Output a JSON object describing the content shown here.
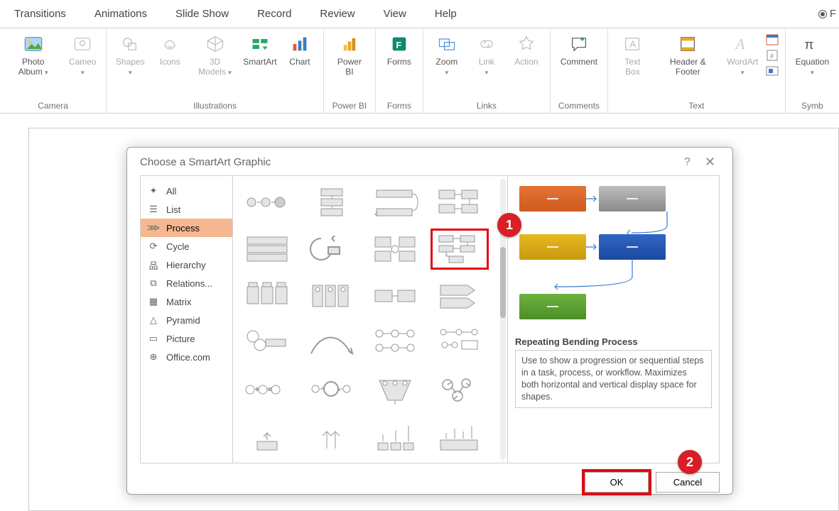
{
  "menu": [
    "Transitions",
    "Animations",
    "Slide Show",
    "Record",
    "Review",
    "View",
    "Help"
  ],
  "ribbon": {
    "camera": {
      "label": "Camera",
      "items": [
        {
          "label": "Photo Album",
          "chev": true,
          "d": false
        },
        {
          "label": "Cameo",
          "chev": true,
          "d": true
        }
      ]
    },
    "illustrations": {
      "label": "Illustrations",
      "items": [
        {
          "label": "Shapes",
          "chev": true,
          "d": true
        },
        {
          "label": "Icons",
          "d": true
        },
        {
          "label": "3D Models",
          "chev": true,
          "d": true
        },
        {
          "label": "SmartArt",
          "d": false
        },
        {
          "label": "Chart",
          "d": false
        }
      ]
    },
    "powerbi": {
      "label": "Power BI",
      "items": [
        {
          "label": "Power BI",
          "d": false
        }
      ]
    },
    "forms": {
      "label": "Forms",
      "items": [
        {
          "label": "Forms",
          "d": false
        }
      ]
    },
    "links": {
      "label": "Links",
      "items": [
        {
          "label": "Zoom",
          "chev": true,
          "d": false
        },
        {
          "label": "Link",
          "chev": true,
          "d": true
        },
        {
          "label": "Action",
          "d": true
        }
      ]
    },
    "comments": {
      "label": "Comments",
      "items": [
        {
          "label": "Comment",
          "d": false
        }
      ]
    },
    "text": {
      "label": "Text",
      "items": [
        {
          "label": "Text Box",
          "d": true
        },
        {
          "label": "Header & Footer",
          "d": false
        },
        {
          "label": "WordArt",
          "chev": true,
          "d": true
        }
      ]
    },
    "symbols": {
      "label": "Symb",
      "items": [
        {
          "label": "Equation",
          "chev": true,
          "d": false
        }
      ]
    }
  },
  "dialog": {
    "title": "Choose a SmartArt Graphic",
    "categories": [
      {
        "label": "All"
      },
      {
        "label": "List"
      },
      {
        "label": "Process",
        "selected": true
      },
      {
        "label": "Cycle"
      },
      {
        "label": "Hierarchy"
      },
      {
        "label": "Relations..."
      },
      {
        "label": "Matrix"
      },
      {
        "label": "Pyramid"
      },
      {
        "label": "Picture"
      },
      {
        "label": "Office.com"
      }
    ],
    "preview": {
      "title": "Repeating Bending Process",
      "desc": "Use to show a progression or sequential steps in a task, process, or workflow. Maximizes both horizontal and vertical display space for shapes."
    },
    "buttons": {
      "ok": "OK",
      "cancel": "Cancel"
    }
  },
  "annotations": {
    "one": "1",
    "two": "2"
  }
}
